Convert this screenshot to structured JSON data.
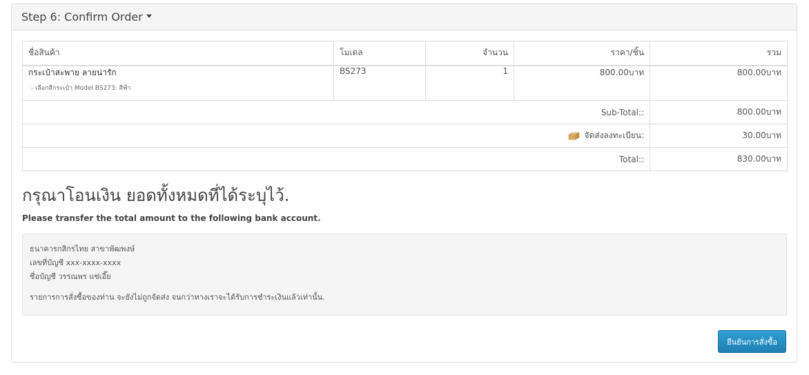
{
  "panel": {
    "title": "Step 6: Confirm Order"
  },
  "table": {
    "headers": [
      "ชื่อสินค้า",
      "โมเดล",
      "จำนวน",
      "ราคา/ชิ้น",
      "รวม"
    ],
    "rows": [
      {
        "name": "กระเป๋าสะพาย ลายน่ารัก",
        "option": "- เลือกสีกระเป๋า Model BS273: สีฟ้า",
        "model": "BS273",
        "quantity": "1",
        "price": "800.00บาท",
        "total": "800.00บาท"
      }
    ],
    "totals": [
      {
        "label": "Sub-Total::",
        "value": "800.00บาท",
        "icon": ""
      },
      {
        "label": "จัดส่งลงทะเบียน:",
        "value": "30.00บาท",
        "icon": "box-icon"
      },
      {
        "label": "Total::",
        "value": "830.00บาท",
        "icon": ""
      }
    ]
  },
  "bank": {
    "title": "กรุณาโอนเงิน ยอดทั้งหมดที่ได้ระบุไว้.",
    "subtitle": "Please transfer the total amount to the following bank account.",
    "line1": "ธนาคารกสิกรไทย สาขาพัฒพงษ์",
    "line2": "เลขที่บัญชี xxx-xxxx-xxxx",
    "line3": "ชื่อบัญชี วรรณพร แซ่เอี๊ย",
    "note": "รายการการสั่งซื้อของท่าน จะยังไม่ถูกจัดส่ง จนกว่าทางเราจะได้รับการชำระเงินแล้วเท่านั้น."
  },
  "buttons": {
    "confirm_label": "ยืนยันการสั่งซื้อ"
  },
  "colors": {
    "button": "#2590c6",
    "panel_heading": "#f5f5f5",
    "well": "#f5f5f5"
  }
}
